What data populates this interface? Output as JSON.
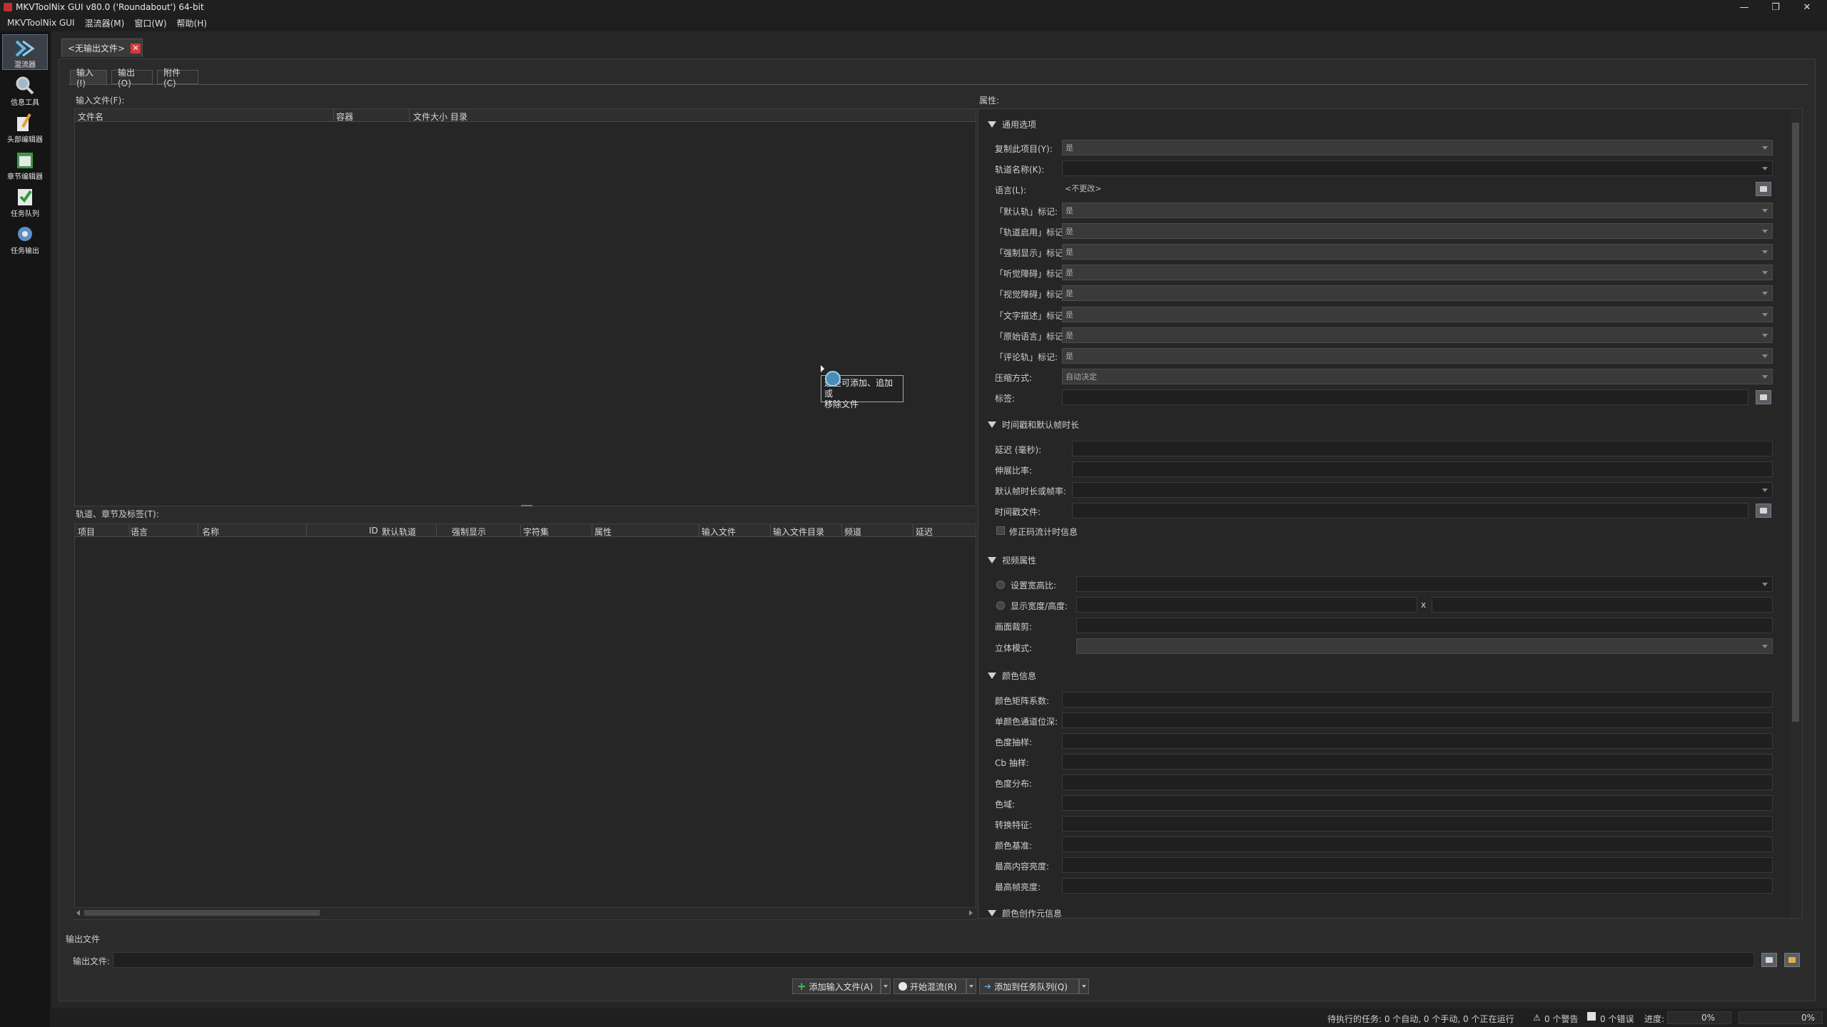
{
  "window": {
    "title": "MKVToolNix GUI v80.0 ('Roundabout') 64-bit"
  },
  "menu": [
    "MKVToolNix GUI",
    "混流器(M)",
    "窗口(W)",
    "帮助(H)"
  ],
  "sidebar": [
    {
      "label": "混流器",
      "icon": "mux-icon"
    },
    {
      "label": "信息工具",
      "icon": "info-tool-icon"
    },
    {
      "label": "头部编辑器",
      "icon": "header-editor-icon"
    },
    {
      "label": "章节编辑器",
      "icon": "chapter-editor-icon"
    },
    {
      "label": "任务队列",
      "icon": "job-queue-icon"
    },
    {
      "label": "任务输出",
      "icon": "job-output-icon"
    }
  ],
  "doc_tab": {
    "label": "<无输出文件>"
  },
  "subtabs": [
    "输入(I)",
    "输出(O)",
    "附件(C)"
  ],
  "input_files": {
    "label": "输入文件(F):",
    "columns": [
      "文件名",
      "容器",
      "文件大小",
      "目录"
    ]
  },
  "tooltip": {
    "line1": "这些可添加、追加或",
    "line2": "移除文件"
  },
  "tracks": {
    "label": "轨道、章节及标签(T):",
    "columns": [
      "项目",
      "语言",
      "名称",
      "ID",
      "默认轨道",
      "强制显示",
      "字符集",
      "属性",
      "输入文件",
      "输入文件目录",
      "频道",
      "延迟"
    ]
  },
  "properties": {
    "label": "属性:",
    "general": {
      "title": "通用选项",
      "rows": [
        {
          "label": "复制此项目(Y):",
          "value": "是",
          "kind": "combo"
        },
        {
          "label": "轨道名称(K):",
          "value": "",
          "kind": "editcombo"
        },
        {
          "label": "语言(L):",
          "value": "<不更改>",
          "kind": "lang"
        },
        {
          "label": "「默认轨」标记:",
          "value": "是",
          "kind": "combo"
        },
        {
          "label": "「轨道启用」标记:",
          "value": "是",
          "kind": "combo"
        },
        {
          "label": "「强制显示」标记:",
          "value": "是",
          "kind": "combo"
        },
        {
          "label": "「听觉障碍」标记:",
          "value": "是",
          "kind": "combo"
        },
        {
          "label": "「视觉障碍」标记:",
          "value": "是",
          "kind": "combo"
        },
        {
          "label": "「文字描述」标记:",
          "value": "是",
          "kind": "combo"
        },
        {
          "label": "「原始语言」标记:",
          "value": "是",
          "kind": "combo"
        },
        {
          "label": "「评论轨」标记:",
          "value": "是",
          "kind": "combo"
        },
        {
          "label": "压缩方式:",
          "value": "自动决定",
          "kind": "combo"
        },
        {
          "label": "标签:",
          "value": "",
          "kind": "file"
        }
      ]
    },
    "timing": {
      "title": "时间戳和默认帧时长",
      "rows": [
        {
          "label": "延迟 (毫秒):"
        },
        {
          "label": "伸展比率:"
        },
        {
          "label": "默认帧时长或帧率:"
        },
        {
          "label": "时间戳文件:"
        }
      ],
      "checkbox": "修正码流计时信息"
    },
    "video": {
      "title": "视频属性",
      "aspect": "设置宽高比:",
      "display": "显示宽度/高度:",
      "times": "x",
      "crop": "画面裁剪:",
      "stereo": "立体模式:"
    },
    "color": {
      "title": "颜色信息",
      "rows": [
        "颜色矩阵系数:",
        "单颜色通道位深:",
        "色度抽样:",
        "Cb 抽样:",
        "色度分布:",
        "色域:",
        "转换特征:",
        "颜色基准:",
        "最高内容亮度:",
        "最高帧亮度:"
      ]
    },
    "mastering": {
      "title": "颜色创作元信息"
    }
  },
  "output": {
    "section": "输出文件",
    "label": "输出文件:"
  },
  "actions": {
    "add": "添加输入文件(A)",
    "start": "开始混流(R)",
    "queue": "添加到任务队列(Q)"
  },
  "status": {
    "jobs": "待执行的任务: 0 个自动, 0 个手动, 0 个正在运行",
    "warnings": "0 个警告",
    "errors": "0 个错误",
    "progress_label": "进度:",
    "progress1": "0%",
    "progress2": "0%"
  }
}
